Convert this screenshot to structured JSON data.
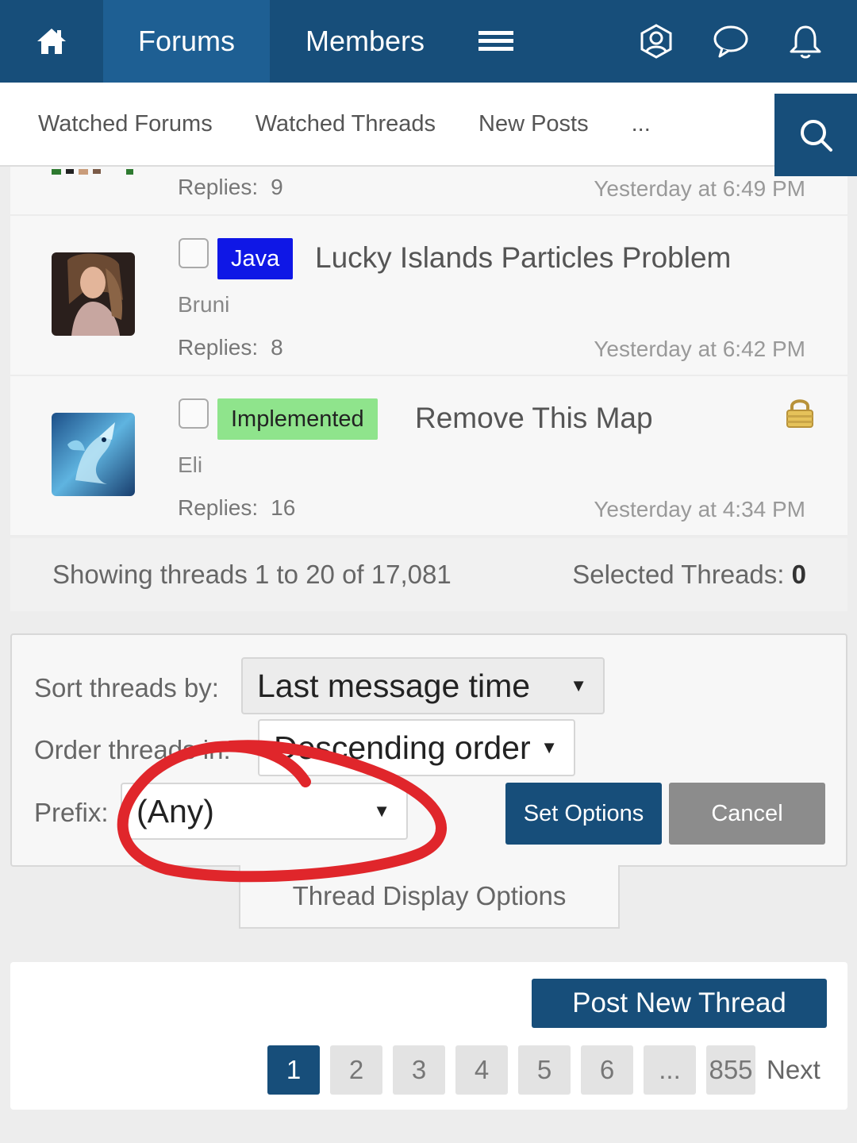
{
  "nav": {
    "tabs": [
      {
        "label": "Forums"
      },
      {
        "label": "Members"
      }
    ],
    "icons": [
      "home-icon",
      "menu-icon",
      "account-icon",
      "conversations-icon",
      "alerts-icon"
    ]
  },
  "subnav": {
    "items": [
      "Watched Forums",
      "Watched Threads",
      "New Posts",
      "..."
    ],
    "search_icon": "search-icon"
  },
  "threads": [
    {
      "replies_label": "Replies:",
      "replies": "9",
      "last_post": "Yesterday at 6:49 PM"
    },
    {
      "prefix": "Java",
      "title": "Lucky Islands Particles Problem",
      "author": "Bruni",
      "replies_label": "Replies:",
      "replies": "8",
      "last_post": "Yesterday at 6:42 PM"
    },
    {
      "prefix": "Implemented",
      "title": "Remove This Map",
      "author": "Eli",
      "replies_label": "Replies:",
      "replies": "16",
      "last_post": "Yesterday at 4:34 PM",
      "locked_icon": "lock-icon"
    }
  ],
  "status": {
    "showing": "Showing threads 1 to 20 of 17,081",
    "selected_label": "Selected Threads:",
    "selected_count": "0"
  },
  "options": {
    "sort_label": "Sort threads by:",
    "sort_value": "Last message time",
    "order_label": "Order threads in:",
    "order_value": "Descending order",
    "prefix_label": "Prefix:",
    "prefix_value": "(Any)",
    "set_button": "Set Options",
    "cancel_button": "Cancel",
    "display_tab": "Thread Display Options"
  },
  "bottom": {
    "post_button": "Post New Thread",
    "pages": [
      "1",
      "2",
      "3",
      "4",
      "5",
      "6",
      "...",
      "855"
    ],
    "current_page": "1",
    "next": "Next"
  },
  "colors": {
    "brand": "#174e7a",
    "java_prefix": "#0f17e6",
    "implemented_prefix": "#8fe48c",
    "annotation": "#e0262b"
  }
}
